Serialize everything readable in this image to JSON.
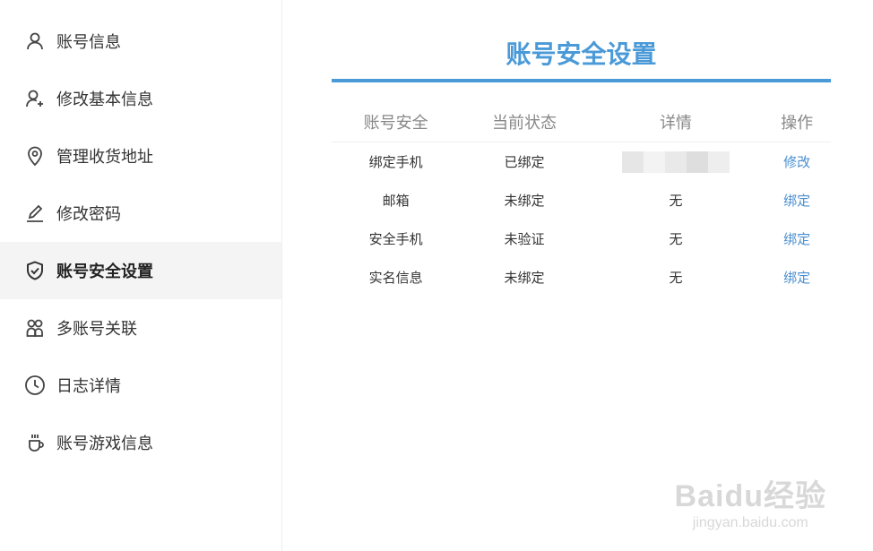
{
  "sidebar": {
    "items": [
      {
        "label": "账号信息",
        "icon": "user-icon"
      },
      {
        "label": "修改基本信息",
        "icon": "user-plus-icon"
      },
      {
        "label": "管理收货地址",
        "icon": "location-pin-icon"
      },
      {
        "label": "修改密码",
        "icon": "pen-icon"
      },
      {
        "label": "账号安全设置",
        "icon": "shield-check-icon",
        "active": true
      },
      {
        "label": "多账号关联",
        "icon": "multi-user-icon"
      },
      {
        "label": "日志详情",
        "icon": "clock-icon"
      },
      {
        "label": "账号游戏信息",
        "icon": "cup-icon"
      }
    ]
  },
  "main": {
    "title": "账号安全设置",
    "table": {
      "headers": [
        "账号安全",
        "当前状态",
        "详情",
        "操作"
      ],
      "rows": [
        {
          "item": "绑定手机",
          "status": "已绑定",
          "detail": "",
          "action": "修改"
        },
        {
          "item": "邮箱",
          "status": "未绑定",
          "detail": "无",
          "action": "绑定"
        },
        {
          "item": "安全手机",
          "status": "未验证",
          "detail": "无",
          "action": "绑定"
        },
        {
          "item": "实名信息",
          "status": "未绑定",
          "detail": "无",
          "action": "绑定"
        }
      ]
    }
  },
  "watermark": {
    "main": "Baidu经验",
    "sub": "jingyan.baidu.com"
  },
  "colors": {
    "accent": "#4a9ad8",
    "link": "#4a8fd0",
    "active_bg": "#f4f4f4"
  }
}
